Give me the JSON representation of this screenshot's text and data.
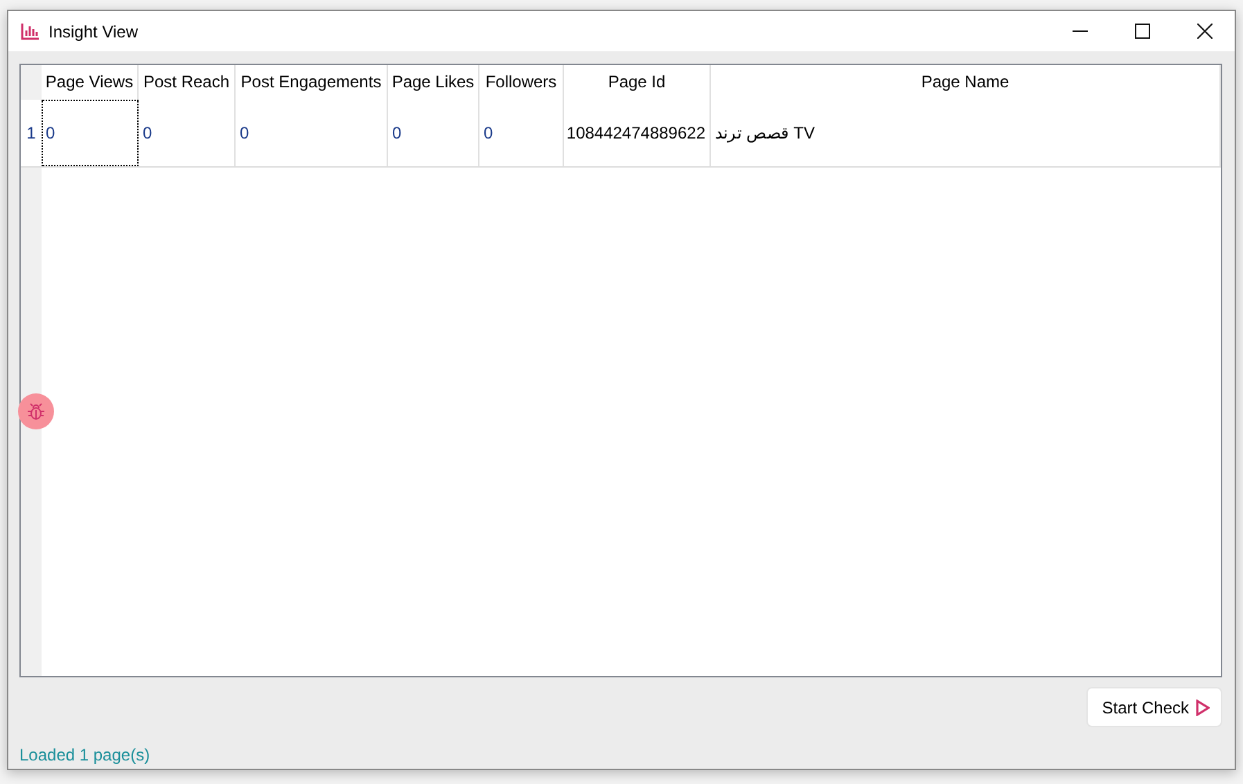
{
  "window": {
    "title": "Insight View"
  },
  "table": {
    "columns": [
      "Page Views",
      "Post Reach",
      "Post Engagements",
      "Page Likes",
      "Followers",
      "Page Id",
      "Page Name"
    ],
    "rows": [
      {
        "header": "1",
        "cells": [
          "0",
          "0",
          "0",
          "0",
          "0",
          "108442474889622",
          "قصص ترند TV"
        ]
      }
    ]
  },
  "buttons": {
    "start": "Start Check"
  },
  "status_bar": "Loaded 1 page(s)"
}
